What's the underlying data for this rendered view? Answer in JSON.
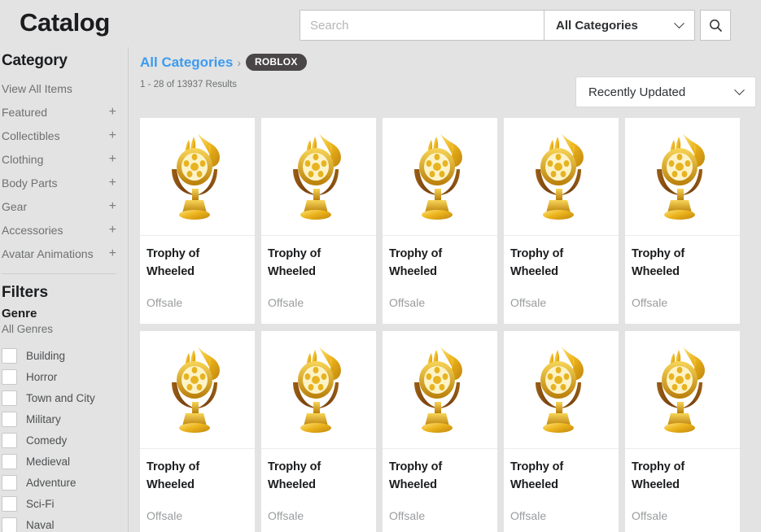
{
  "header": {
    "title": "Catalog",
    "search": {
      "placeholder": "Search",
      "value": "",
      "category_label": "All Categories",
      "search_icon": "search-icon",
      "chevron_icon": "chevron-down-icon"
    }
  },
  "sidebar": {
    "category_heading": "Category",
    "categories": [
      {
        "label": "View All Items",
        "expandable": false
      },
      {
        "label": "Featured",
        "expandable": true,
        "expander": "+"
      },
      {
        "label": "Collectibles",
        "expandable": true,
        "expander": "+"
      },
      {
        "label": "Clothing",
        "expandable": true,
        "expander": "+"
      },
      {
        "label": "Body Parts",
        "expandable": true,
        "expander": "+"
      },
      {
        "label": "Gear",
        "expandable": true,
        "expander": "+"
      },
      {
        "label": "Accessories",
        "expandable": true,
        "expander": "+"
      },
      {
        "label": "Avatar Animations",
        "expandable": true,
        "expander": "+"
      }
    ],
    "filters_heading": "Filters",
    "genre_heading": "Genre",
    "all_genres_label": "All Genres",
    "genres": [
      {
        "label": "Building",
        "checked": false
      },
      {
        "label": "Horror",
        "checked": false
      },
      {
        "label": "Town and City",
        "checked": false
      },
      {
        "label": "Military",
        "checked": false
      },
      {
        "label": "Comedy",
        "checked": false
      },
      {
        "label": "Medieval",
        "checked": false
      },
      {
        "label": "Adventure",
        "checked": false
      },
      {
        "label": "Sci-Fi",
        "checked": false
      },
      {
        "label": "Naval",
        "checked": false
      }
    ]
  },
  "main": {
    "breadcrumb": {
      "root_label": "All Categories",
      "separator": "›",
      "current_label": "ROBLOX"
    },
    "results_count": "1 - 28 of 13937 Results",
    "sort": {
      "selected": "Recently Updated",
      "chevron_icon": "chevron-down-icon"
    },
    "items": [
      {
        "title": "Trophy of Wheeled",
        "status": "Offsale",
        "thumb": "gold-trophy-icon"
      },
      {
        "title": "Trophy of Wheeled",
        "status": "Offsale",
        "thumb": "gold-trophy-icon"
      },
      {
        "title": "Trophy of Wheeled",
        "status": "Offsale",
        "thumb": "gold-trophy-icon"
      },
      {
        "title": "Trophy of Wheeled",
        "status": "Offsale",
        "thumb": "gold-trophy-icon"
      },
      {
        "title": "Trophy of Wheeled",
        "status": "Offsale",
        "thumb": "gold-trophy-icon"
      },
      {
        "title": "Trophy of Wheeled",
        "status": "Offsale",
        "thumb": "gold-trophy-icon"
      },
      {
        "title": "Trophy of Wheeled",
        "status": "Offsale",
        "thumb": "gold-trophy-icon"
      },
      {
        "title": "Trophy of Wheeled",
        "status": "Offsale",
        "thumb": "gold-trophy-icon"
      },
      {
        "title": "Trophy of Wheeled",
        "status": "Offsale",
        "thumb": "gold-trophy-icon"
      },
      {
        "title": "Trophy of Wheeled",
        "status": "Offsale",
        "thumb": "gold-trophy-icon"
      }
    ]
  },
  "colors": {
    "page_background": "#e3e3e3",
    "card_background": "#ffffff",
    "link_blue": "#3b9bf0",
    "pill_dark": "#4a4647",
    "muted_text": "#9a9c9e",
    "trophy_gold": "#e8b317"
  }
}
